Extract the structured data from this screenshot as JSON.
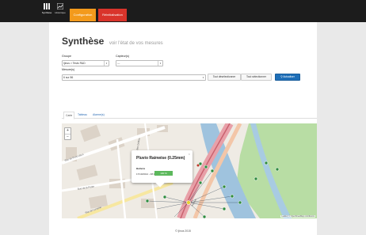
{
  "nav": {
    "items": [
      {
        "label": "Synthèse",
        "icon": "grid-icon",
        "active": true
      },
      {
        "label": "Historique",
        "icon": "chart-icon",
        "active": false
      }
    ],
    "config_label": "Configuration",
    "reinit_label": "Réinitialisation"
  },
  "colors": {
    "config": "#f39a1c",
    "reinit": "#d9342b",
    "primary": "#1f6fb8",
    "badge": "#5cb85c"
  },
  "header": {
    "title": "Synthèse",
    "subtitle": "voir l'état de vos mesures"
  },
  "filters": {
    "groupe_label": "Groupe",
    "groupe_value": "Ijinus > Tests R&D",
    "capteurs_label": "Capteur(s)",
    "capteurs_value": "---",
    "mesures_label": "Mesure(s)",
    "mesures_value": "6 sur 86",
    "deselect_label": "Tout désélectionner",
    "select_label": "Tout sélectionner",
    "refresh_label": "Actualiser"
  },
  "tabs": [
    "Carte",
    "Tableau",
    "Alarme(s)"
  ],
  "map": {
    "zoom_in": "+",
    "zoom_out": "−",
    "streets": [
      "Rue du Pont Léton",
      "Rue de la Poste",
      "Rue des Cèdres",
      "Rue de Lorraine",
      "Avenue"
    ],
    "popup": {
      "title": "Pluvio Rainwise (0.25mm)",
      "section": "Batterie",
      "date": "17/10/2014 - 08:17:44",
      "badge": "100 %",
      "close": "×"
    },
    "attribution": "Leaflet | © OpenStreetMap contributors"
  },
  "footer": "© Ijinus 2015"
}
